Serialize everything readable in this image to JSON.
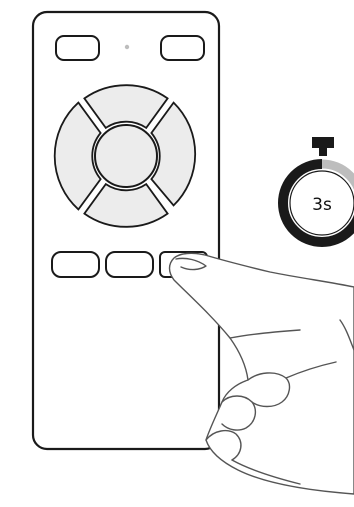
{
  "timer": {
    "label": "3s",
    "ring_progress": 0.75,
    "ring_color": "#1a1a1a",
    "ring_remaining_color": "#bdbdbd",
    "cap_color": "#1a1a1a"
  },
  "remote": {
    "icon": "remote-control-icon",
    "stroke_color": "#1a1a1a",
    "dpad_fill": "#e8e8e8",
    "pressed_button": "bottom-right-button"
  },
  "hand": {
    "icon": "pointing-hand-icon",
    "stroke_color": "#555555"
  }
}
